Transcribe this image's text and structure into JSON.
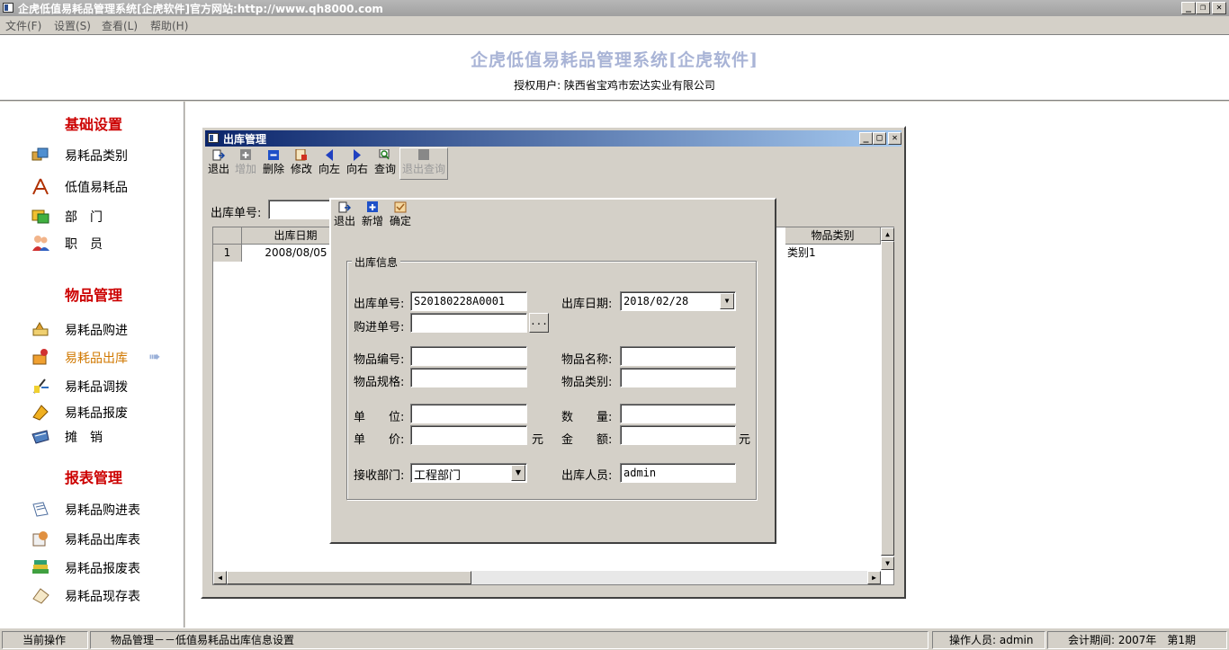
{
  "window": {
    "title": "企虎低值易耗品管理系统[企虎软件]官方网站:http://www.qh8000.com"
  },
  "menu": [
    "文件(F)",
    "设置(S)",
    "查看(L)",
    "帮助(H)"
  ],
  "header": {
    "system_title": "企虎低值易耗品管理系统[企虎软件]",
    "authorized_user": "授权用户: 陕西省宝鸡市宏达实业有限公司"
  },
  "sidebar": {
    "sections": [
      {
        "title": "基础设置",
        "items": [
          "易耗品类别",
          "低值易耗品",
          "部　门",
          "职　员"
        ]
      },
      {
        "title": "物品管理",
        "items": [
          "易耗品购进",
          "易耗品出库",
          "易耗品调拨",
          "易耗品报废",
          "摊　销"
        ]
      },
      {
        "title": "报表管理",
        "items": [
          "易耗品购进表",
          "易耗品出库表",
          "易耗品报废表",
          "易耗品现存表"
        ]
      }
    ],
    "active_item": "易耗品出库",
    "arrow": "➠"
  },
  "mdi": {
    "title": "出库管理",
    "toolbar": [
      {
        "label": "退出",
        "icon": "exit-icon",
        "enabled": true
      },
      {
        "label": "增加",
        "icon": "add-icon",
        "enabled": false
      },
      {
        "label": "删除",
        "icon": "delete-icon",
        "enabled": true
      },
      {
        "label": "修改",
        "icon": "edit-icon",
        "enabled": true
      },
      {
        "label": "向左",
        "icon": "left-icon",
        "enabled": true
      },
      {
        "label": "向右",
        "icon": "right-icon",
        "enabled": true
      },
      {
        "label": "查询",
        "icon": "query-icon",
        "enabled": true
      },
      {
        "label": "退出查询",
        "icon": "exit-query-icon",
        "enabled": false
      }
    ],
    "search_label": "出库单号:",
    "search_value": "",
    "grid": {
      "columns": [
        "出库日期",
        "物品类别"
      ],
      "rows": [
        {
          "num": "1",
          "date": "2008/08/05",
          "category": "类别1"
        }
      ]
    }
  },
  "dialog": {
    "toolbar": [
      {
        "label": "退出",
        "icon": "exit-icon",
        "enabled": true
      },
      {
        "label": "新增",
        "icon": "new-icon",
        "enabled": true
      },
      {
        "label": "确定",
        "icon": "confirm-icon",
        "enabled": true
      }
    ],
    "group_title": "出库信息",
    "fields": {
      "out_no_label": "出库单号:",
      "out_no_value": "S20180228A0001",
      "out_date_label": "出库日期:",
      "out_date_value": "2018/02/28",
      "purchase_no_label": "购进单号:",
      "purchase_no_value": "",
      "browse_label": "...",
      "item_code_label": "物品编号:",
      "item_code_value": "",
      "item_name_label": "物品名称:",
      "item_name_value": "",
      "item_spec_label": "物品规格:",
      "item_spec_value": "",
      "item_cat_label": "物品类别:",
      "item_cat_value": "",
      "unit_label": "单　　位:",
      "unit_value": "",
      "qty_label": "数　　量:",
      "qty_value": "",
      "price_label": "单　　价:",
      "price_value": "",
      "price_unit": "元",
      "amount_label": "金　　额:",
      "amount_value": "",
      "amount_unit": "元",
      "dept_label": "接收部门:",
      "dept_value": "工程部门",
      "operator_label": "出库人员:",
      "operator_value": "admin"
    }
  },
  "statusbar": {
    "current_label": "当前操作",
    "current_value": "物品管理－－低值易耗品出库信息设置",
    "operator": "操作人员: admin",
    "period": "会计期间: 2007年　第1期"
  }
}
